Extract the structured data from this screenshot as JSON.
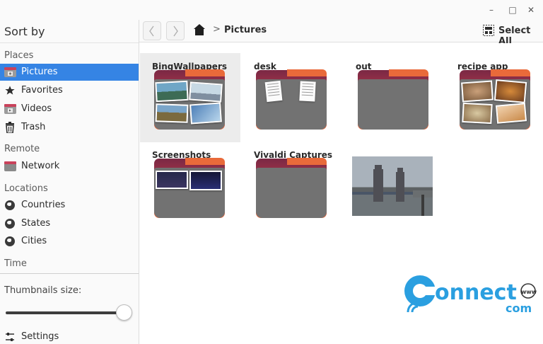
{
  "sidebar": {
    "sort_by": "Sort by",
    "sections": {
      "places": "Places",
      "remote": "Remote",
      "locations": "Locations",
      "time": "Time"
    },
    "places": [
      {
        "label": "Pictures",
        "icon": "pictures-folder-icon",
        "active": true
      },
      {
        "label": "Favorites",
        "icon": "star-icon"
      },
      {
        "label": "Videos",
        "icon": "videos-folder-icon"
      },
      {
        "label": "Trash",
        "icon": "trash-icon"
      }
    ],
    "remote": [
      {
        "label": "Network",
        "icon": "network-folder-icon"
      }
    ],
    "locations": [
      {
        "label": "Countries",
        "icon": "globe-icon"
      },
      {
        "label": "States",
        "icon": "globe-icon"
      },
      {
        "label": "Cities",
        "icon": "globe-icon"
      }
    ],
    "thumbnails_label": "Thumbnails size:",
    "thumbnail_size_level": 1.0,
    "settings_label": "Settings"
  },
  "toolbar": {
    "back_icon": "chevron-left-icon",
    "forward_icon": "chevron-right-icon",
    "home_icon": "home-icon",
    "breadcrumb_sep": ">",
    "breadcrumb": "Pictures",
    "select_all": "Select All"
  },
  "items": [
    {
      "name": "BingWallpapers",
      "kind": "folder",
      "preview": "photos"
    },
    {
      "name": "desk",
      "kind": "folder",
      "preview": "documents"
    },
    {
      "name": "out",
      "kind": "folder",
      "preview": "empty"
    },
    {
      "name": "recipe app",
      "kind": "folder",
      "preview": "photos"
    },
    {
      "name": "Screenshots",
      "kind": "folder",
      "preview": "screenshots"
    },
    {
      "name": "Vivaldi Captures",
      "kind": "folder",
      "preview": "empty"
    },
    {
      "name": "",
      "kind": "image",
      "preview": "tower-bridge-photo"
    }
  ],
  "watermark": {
    "text": "connect",
    "suffix": "com",
    "badge": "www"
  },
  "colors": {
    "accent": "#3584e4",
    "folder_top": "#c33d4f",
    "folder_tab": "#e96a3a",
    "folder_front": "#727272",
    "logo_blue": "#2a9fe0"
  }
}
